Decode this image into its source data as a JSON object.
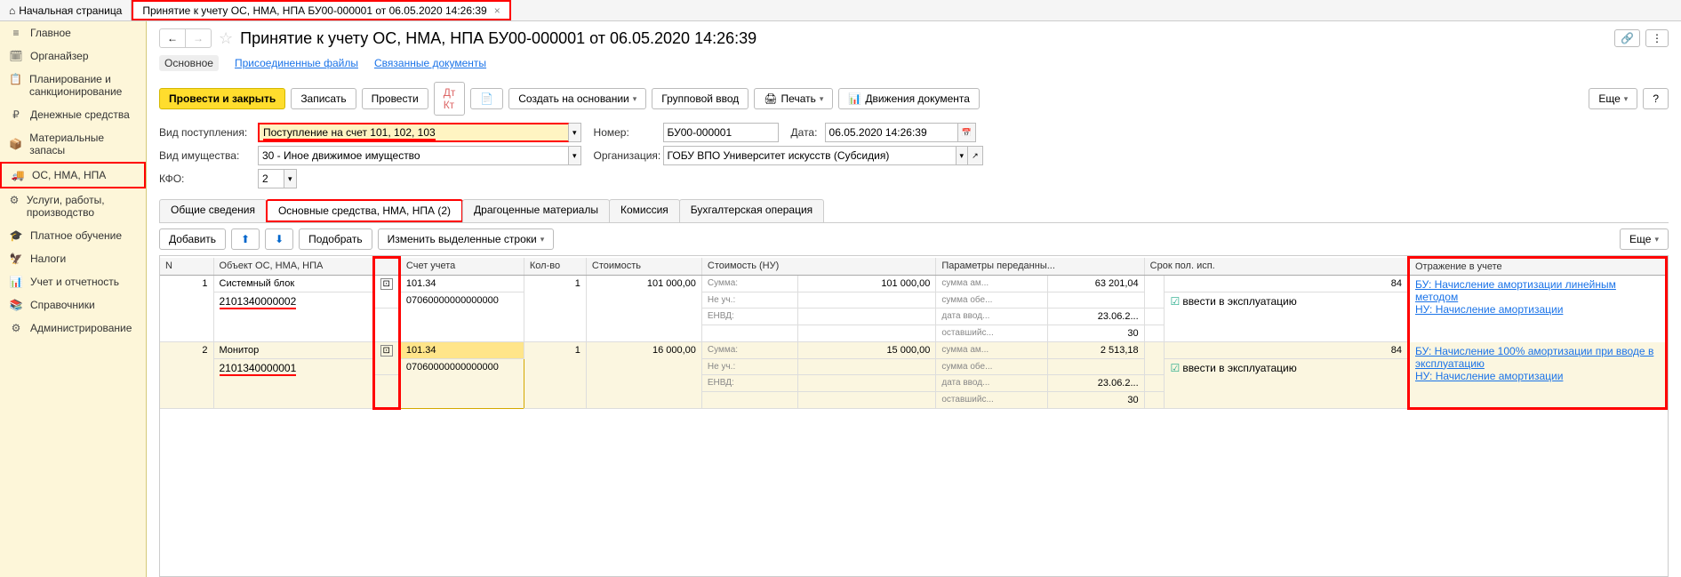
{
  "tabs": {
    "home": "Начальная страница",
    "active": "Принятие к учету ОС, НМА, НПА БУ00-000001 от 06.05.2020 14:26:39"
  },
  "sidebar": [
    {
      "icon": "≡",
      "label": "Главное"
    },
    {
      "icon": "🗓",
      "label": "Органайзер"
    },
    {
      "icon": "📋",
      "label": "Планирование и санкционирование"
    },
    {
      "icon": "₽",
      "label": "Денежные средства"
    },
    {
      "icon": "📦",
      "label": "Материальные запасы"
    },
    {
      "icon": "🚚",
      "label": "ОС, НМА, НПА"
    },
    {
      "icon": "⚙",
      "label": "Услуги, работы, производство"
    },
    {
      "icon": "🎓",
      "label": "Платное обучение"
    },
    {
      "icon": "🦅",
      "label": "Налоги"
    },
    {
      "icon": "📊",
      "label": "Учет и отчетность"
    },
    {
      "icon": "📚",
      "label": "Справочники"
    },
    {
      "icon": "⚙",
      "label": "Администрирование"
    }
  ],
  "title": "Принятие к учету ОС, НМА, НПА БУ00-000001 от 06.05.2020 14:26:39",
  "subnav": {
    "main": "Основное",
    "files": "Присоединенные файлы",
    "related": "Связанные документы"
  },
  "toolbar": {
    "post_close": "Провести и закрыть",
    "save": "Записать",
    "post": "Провести",
    "create_on": "Создать на основании",
    "group_input": "Групповой ввод",
    "print": "Печать",
    "movements": "Движения документа",
    "more": "Еще"
  },
  "form": {
    "receipt_type_label": "Вид поступления:",
    "receipt_type": "Поступление на счет 101, 102, 103",
    "number_label": "Номер:",
    "number": "БУ00-000001",
    "date_label": "Дата:",
    "date": "06.05.2020 14:26:39",
    "asset_type_label": "Вид имущества:",
    "asset_type": "30 - Иное движимое имущество",
    "org_label": "Организация:",
    "org": "ГОБУ ВПО Университет искусств (Субсидия)",
    "kfo_label": "КФО:",
    "kfo": "2"
  },
  "doc_tabs": {
    "general": "Общие сведения",
    "main_assets": "Основные средства, НМА, НПА (2)",
    "precious": "Драгоценные материалы",
    "commission": "Комиссия",
    "accounting": "Бухгалтерская операция"
  },
  "sub_toolbar": {
    "add": "Добавить",
    "pick": "Подобрать",
    "edit_sel": "Изменить выделенные строки",
    "more": "Еще"
  },
  "table": {
    "headers": {
      "n": "N",
      "object": "Объект ОС, НМА, НПА",
      "account": "Счет учета",
      "qty": "Кол-во",
      "cost": "Стоимость",
      "cost_nu": "Стоимость (НУ)",
      "params": "Параметры переданны...",
      "term": "Срок пол. исп.",
      "reflection": "Отражение в учете"
    },
    "rows": [
      {
        "n": "1",
        "name": "Системный блок",
        "inv": "2101340000002",
        "account1": "101.34",
        "account2": "07060000000000000",
        "qty": "1",
        "cost": "101 000,00",
        "nu_sum_label": "Сумма:",
        "nu_sum": "101 000,00",
        "nu_noacc": "Не уч.:",
        "nu_envd": "ЕНВД:",
        "param_sum_am": "сумма ам...",
        "param_sum_am_val": "63 201,04",
        "param_sum_ob": "сумма обе...",
        "param_date": "дата ввод...",
        "param_date_val": "23.06.2...",
        "param_remain": "оставшийс...",
        "param_remain_val": "30",
        "term": "84",
        "check_label": "ввести в эксплуатацию",
        "ref1": "БУ: Начисление амортизации линейным методом",
        "ref2": "НУ: Начисление амортизации"
      },
      {
        "n": "2",
        "name": "Монитор",
        "inv": "2101340000001",
        "account1": "101.34",
        "account2": "07060000000000000",
        "qty": "1",
        "cost": "16 000,00",
        "nu_sum_label": "Сумма:",
        "nu_sum": "15 000,00",
        "nu_noacc": "Не уч.:",
        "nu_envd": "ЕНВД:",
        "param_sum_am": "сумма ам...",
        "param_sum_am_val": "2 513,18",
        "param_sum_ob": "сумма обе...",
        "param_date": "дата ввод...",
        "param_date_val": "23.06.2...",
        "param_remain": "оставшийс...",
        "param_remain_val": "30",
        "term": "84",
        "check_label": "ввести в эксплуатацию",
        "ref1": "БУ: Начисление 100% амортизации при вводе в эксплуатацию",
        "ref2": "НУ: Начисление амортизации"
      }
    ]
  }
}
